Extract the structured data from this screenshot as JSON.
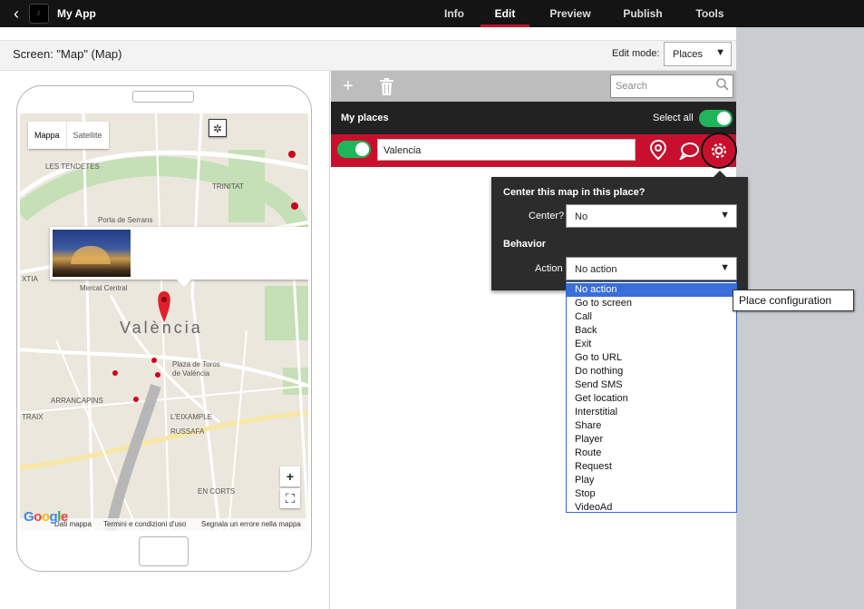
{
  "app": {
    "name": "My App",
    "back_glyph": "‹"
  },
  "nav": [
    {
      "label": "Info",
      "active": false
    },
    {
      "label": "Edit",
      "active": true
    },
    {
      "label": "Preview",
      "active": false
    },
    {
      "label": "Publish",
      "active": false
    },
    {
      "label": "Tools",
      "active": false
    }
  ],
  "screen": {
    "label": "Screen: \"Map\" (Map)"
  },
  "edit_mode": {
    "label": "Edit mode:",
    "value": "Places"
  },
  "map": {
    "type_buttons": {
      "map": "Mappa",
      "satellite": "Satellite"
    },
    "labels": {
      "tendetes": "LES TENDETES",
      "trinitat": "TRINITAT",
      "porta": "Porta de Serrans",
      "mercat": "Mercat Central",
      "city": "València",
      "plaza1": "Plaza de Toros",
      "plaza2": "de València",
      "arrancapins": "ARRANCAPINS",
      "eixample": "L'EIXAMPLE",
      "russafa": "RUSSAFA",
      "encorts": "EN CORTS",
      "xtia": "XTIA",
      "traix": "TRAIX"
    },
    "zoom_in": "+",
    "footer": {
      "data": "Dati mappa",
      "terms": "Termini e condizioni d'uso",
      "report": "Segnala un errore nella mappa"
    },
    "google_logo": "Google"
  },
  "toolbar": {
    "add": "+",
    "search_placeholder": "Search"
  },
  "places": {
    "title": "My places",
    "select_all": "Select all",
    "select_all_on": true,
    "rows": [
      {
        "enabled": true,
        "name": "Valencia"
      }
    ]
  },
  "config": {
    "title": "Center this map in this place?",
    "center_label": "Center?",
    "center_value": "No",
    "behavior_title": "Behavior",
    "action_label": "Action",
    "action_value": "No action",
    "options": [
      "No action",
      "Go to screen",
      "Call",
      "Back",
      "Exit",
      "Go to URL",
      "Do nothing",
      "Send SMS",
      "Get location",
      "Interstitial",
      "Share",
      "Player",
      "Route",
      "Request",
      "Play",
      "Stop",
      "VideoAd"
    ],
    "selected_index": 0
  },
  "tooltip": "Place configuration",
  "colors": {
    "brand_red": "#c8102e",
    "toggle_green": "#1fb65b",
    "topbar": "#141414",
    "selection_blue": "#3a6ed8"
  }
}
